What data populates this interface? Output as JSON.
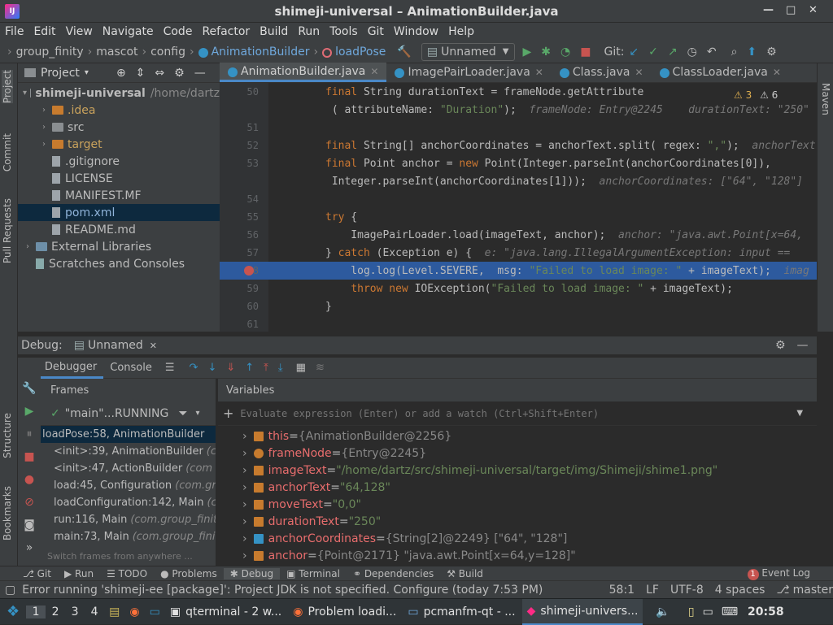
{
  "window": {
    "title": "shimeji-universal – AnimationBuilder.java",
    "app_icon": "IJ",
    "controls": [
      "—",
      "□",
      "✕"
    ]
  },
  "menu": [
    "File",
    "Edit",
    "View",
    "Navigate",
    "Code",
    "Refactor",
    "Build",
    "Run",
    "Tools",
    "Git",
    "Window",
    "Help"
  ],
  "breadcrumbs": [
    "group_finity",
    "mascot",
    "config",
    "AnimationBuilder",
    "loadPose"
  ],
  "run_config": "Unnamed",
  "git_label": "Git:",
  "project_panel": {
    "title": "Project",
    "tree": [
      {
        "label": "shimeji-universal",
        "suffix": "/home/dartz",
        "arrow": "▾",
        "indent": 0,
        "kind": "root"
      },
      {
        "label": ".idea",
        "arrow": "›",
        "indent": 1,
        "kind": "folder-orange"
      },
      {
        "label": "src",
        "arrow": "›",
        "indent": 1,
        "kind": "folder"
      },
      {
        "label": "target",
        "arrow": "›",
        "indent": 1,
        "kind": "folder-orange"
      },
      {
        "label": ".gitignore",
        "arrow": "",
        "indent": 1,
        "kind": "file"
      },
      {
        "label": "LICENSE",
        "arrow": "",
        "indent": 1,
        "kind": "file"
      },
      {
        "label": "MANIFEST.MF",
        "arrow": "",
        "indent": 1,
        "kind": "file"
      },
      {
        "label": "pom.xml",
        "arrow": "",
        "indent": 1,
        "kind": "file",
        "selected": true
      },
      {
        "label": "README.md",
        "arrow": "",
        "indent": 1,
        "kind": "file"
      },
      {
        "label": "External Libraries",
        "arrow": "›",
        "indent": 0,
        "kind": "lib"
      },
      {
        "label": "Scratches and Consoles",
        "arrow": "",
        "indent": 0,
        "kind": "scratch"
      }
    ]
  },
  "side_labels": {
    "project": "Project",
    "commit": "Commit",
    "pull_requests": "Pull Requests",
    "structure": "Structure",
    "bookmarks": "Bookmarks",
    "maven": "Maven"
  },
  "editor_tabs": [
    "AnimationBuilder.java",
    "ImagePairLoader.java",
    "Class.java",
    "ClassLoader.java"
  ],
  "inspections": {
    "warnings": "3",
    "weak": "6"
  },
  "code_lines": [
    {
      "n": "50",
      "code": "final String durationText = frameNode.getAttribute",
      "hint": ""
    },
    {
      "n": "",
      "code": " ( attributeName: \"Duration\");",
      "hint": "  frameNode: Entry@2245    durationText: \"250\""
    },
    {
      "n": "51",
      "code": "",
      "hint": ""
    },
    {
      "n": "52",
      "code": "final String[] anchorCoordinates = anchorText.split( regex: \",\");",
      "hint": "  anchorText"
    },
    {
      "n": "53",
      "code": "final Point anchor = new Point(Integer.parseInt(anchorCoordinates[0]),",
      "hint": ""
    },
    {
      "n": "",
      "code": " Integer.parseInt(anchorCoordinates[1]));",
      "hint": "  anchorCoordinates: [\"64\", \"128\"]"
    },
    {
      "n": "54",
      "code": "",
      "hint": ""
    },
    {
      "n": "55",
      "code": "try {",
      "hint": ""
    },
    {
      "n": "56",
      "code": "    ImagePairLoader.load(imageText, anchor);",
      "hint": "  anchor: \"java.awt.Point[x=64,"
    },
    {
      "n": "57",
      "code": "} catch (Exception e) {",
      "hint": "  e: \"java.lang.IllegalArgumentException: input == "
    },
    {
      "n": "58",
      "code": "    log.log(Level.SEVERE,  msg: \"Failed to load image: \" + imageText);",
      "hint": "  imag",
      "selected": true
    },
    {
      "n": "59",
      "code": "    throw new IOException(\"Failed to load image: \" + imageText);",
      "hint": ""
    },
    {
      "n": "60",
      "code": "}",
      "hint": ""
    },
    {
      "n": "61",
      "code": "",
      "hint": ""
    }
  ],
  "debug": {
    "label": "Debug:",
    "session": "Unnamed",
    "tabs": [
      "Debugger",
      "Console"
    ],
    "frames_title": "Frames",
    "variables_title": "Variables",
    "thread": "\"main\"...RUNNING",
    "frames": [
      {
        "method": "loadPose:58, AnimationBuilder",
        "pkg": "",
        "selected": true
      },
      {
        "method": "<init>:39, AnimationBuilder",
        "pkg": "(c"
      },
      {
        "method": "<init>:47, ActionBuilder",
        "pkg": "(com"
      },
      {
        "method": "load:45, Configuration",
        "pkg": "(com.gr"
      },
      {
        "method": "loadConfiguration:142, Main",
        "pkg": "(co"
      },
      {
        "method": "run:116, Main",
        "pkg": "(com.group_finity"
      },
      {
        "method": "main:73, Main",
        "pkg": "(com.group_finit"
      }
    ],
    "frames_hint": "Switch frames from anywhere ...",
    "eval_placeholder": "Evaluate expression (Enter) or add a watch (Ctrl+Shift+Enter)",
    "variables": [
      {
        "name": "this",
        "value": "{AnimationBuilder@2256}",
        "kind": "ref"
      },
      {
        "name": "frameNode",
        "value": "{Entry@2245}",
        "kind": "param"
      },
      {
        "name": "imageText",
        "value": "\"/home/dartz/src/shimeji-universal/target/img/Shimeji/shime1.png\"",
        "kind": "str"
      },
      {
        "name": "anchorText",
        "value": "\"64,128\"",
        "kind": "str"
      },
      {
        "name": "moveText",
        "value": "\"0,0\"",
        "kind": "str"
      },
      {
        "name": "durationText",
        "value": "\"250\"",
        "kind": "str"
      },
      {
        "name": "anchorCoordinates",
        "value": "{String[2]@2249} [\"64\", \"128\"]",
        "kind": "arr"
      },
      {
        "name": "anchor",
        "value": "{Point@2171} \"java.awt.Point[x=64,y=128]\"",
        "kind": "ref"
      }
    ]
  },
  "bottom_tabs": [
    "Git",
    "Run",
    "TODO",
    "Problems",
    "Debug",
    "Terminal",
    "Dependencies",
    "Build"
  ],
  "event_log": {
    "count": "1",
    "label": "Event Log"
  },
  "status": {
    "message": "Error running 'shimeji-ee [package]': Project JDK is not specified. Configure (today 7:53 PM)",
    "position": "58:1",
    "line_sep": "LF",
    "encoding": "UTF-8",
    "indent": "4 spaces",
    "branch": "master"
  },
  "taskbar": {
    "workspaces": [
      "1",
      "2",
      "3",
      "4"
    ],
    "apps": [
      "qterminal - 2 w...",
      "Problem loadi...",
      "pcmanfm-qt - ...",
      "shimeji-univers..."
    ],
    "clock": "20:58"
  }
}
